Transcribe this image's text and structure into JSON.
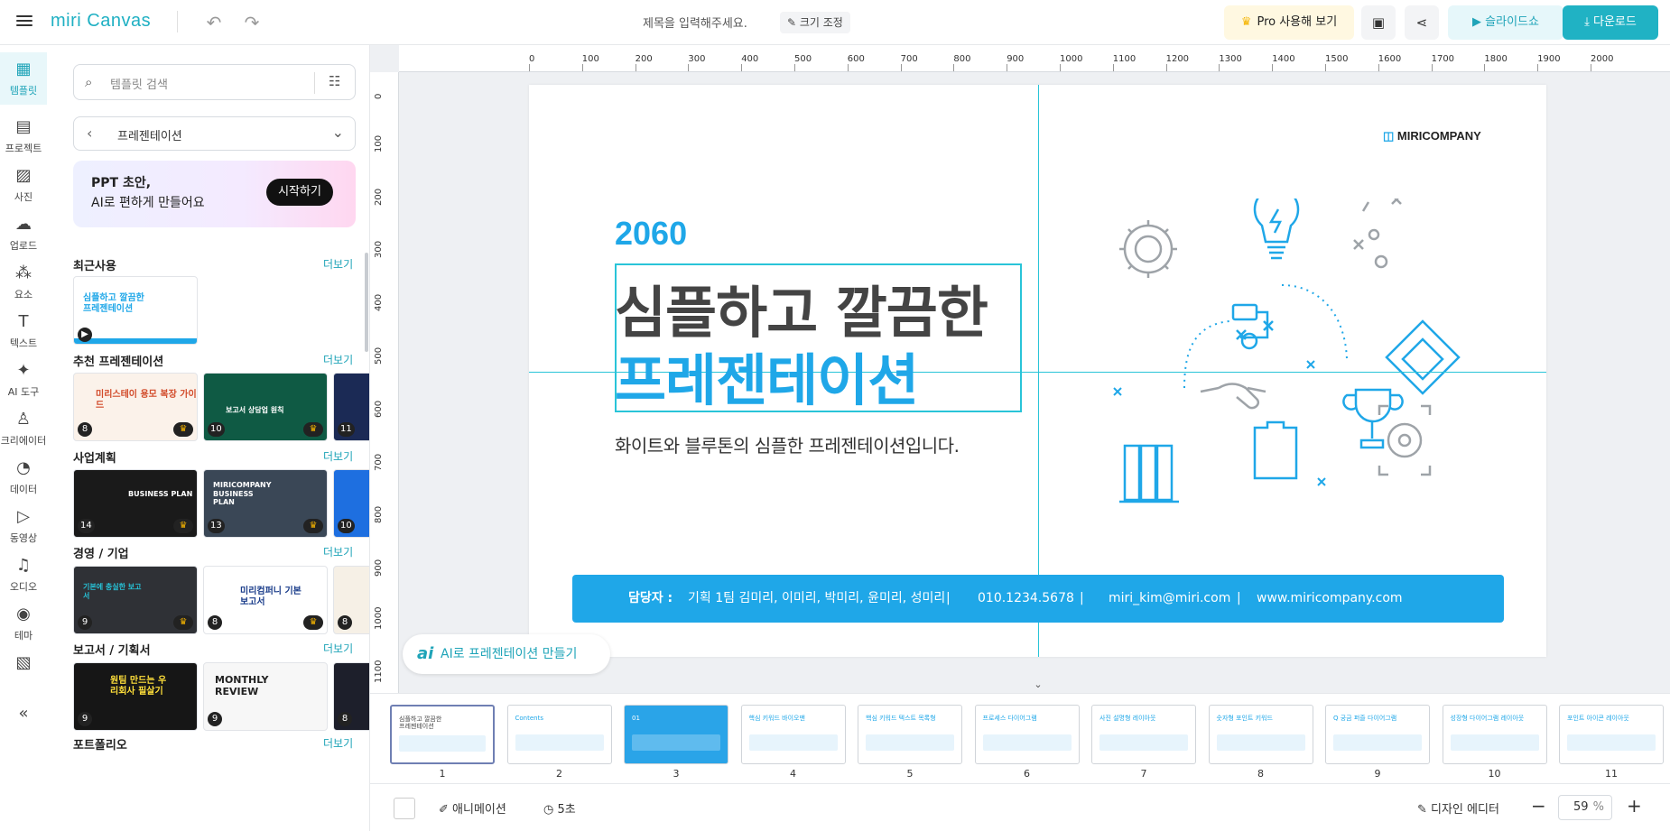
{
  "topbar": {
    "logo": "miri Canvas",
    "doc_title_placeholder": "제목을 입력해주세요.",
    "resize_label": "크기 조정",
    "pro_label": "Pro 사용해 보기",
    "slideshow_label": "슬라이드쇼",
    "download_label": "다운로드",
    "accent_color": "#20b2c4"
  },
  "leftbar": {
    "items": [
      {
        "label": "템플릿",
        "icon": "template-icon"
      },
      {
        "label": "프로젝트",
        "icon": "project-icon"
      },
      {
        "label": "사진",
        "icon": "photo-icon"
      },
      {
        "label": "업로드",
        "icon": "upload-icon"
      },
      {
        "label": "요소",
        "icon": "elements-icon"
      },
      {
        "label": "텍스트",
        "icon": "text-icon"
      },
      {
        "label": "AI 도구",
        "icon": "ai-tools-icon"
      },
      {
        "label": "크리에이터",
        "icon": "creator-icon"
      },
      {
        "label": "데이터",
        "icon": "data-icon"
      },
      {
        "label": "동영상",
        "icon": "video-icon"
      },
      {
        "label": "오디오",
        "icon": "audio-icon"
      },
      {
        "label": "테마",
        "icon": "theme-icon"
      },
      {
        "label": "",
        "icon": "pattern-icon"
      }
    ]
  },
  "panel": {
    "search_placeholder": "템플릿 검색",
    "category": "프레젠테이션",
    "banner_line1": "PPT 초안,",
    "banner_line2": "AI로 편하게 만들어요",
    "banner_button": "시작하기",
    "more_label": "더보기",
    "sections": [
      {
        "title": "최근사용",
        "thumbs": [
          {
            "text": "심플하고 깔끔한 프레젠테이션",
            "badge": ""
          }
        ]
      },
      {
        "title": "추천 프레젠테이션",
        "thumbs": [
          {
            "text": "미리스테이 용모 복장 가이드",
            "badge": "8"
          },
          {
            "text": "보고서 상담업 원칙",
            "badge": "10"
          },
          {
            "text": "",
            "badge": "11"
          }
        ]
      },
      {
        "title": "사업계획",
        "thumbs": [
          {
            "text": "BUSINESS PLAN",
            "badge": "14"
          },
          {
            "text": "MIRICOMPANY BUSINESS PLAN",
            "badge": "13"
          },
          {
            "text": "",
            "badge": "10"
          }
        ]
      },
      {
        "title": "경영 / 기업",
        "thumbs": [
          {
            "text": "기본에 충실한 보고서",
            "badge": "9"
          },
          {
            "text": "미리컴퍼니 기본 보고서",
            "badge": "8"
          },
          {
            "text": "",
            "badge": "8"
          }
        ]
      },
      {
        "title": "보고서 / 기획서",
        "thumbs": [
          {
            "text": "원팀 만드는 우리회사 필살기",
            "badge": "9"
          },
          {
            "text": "MONTHLY REVIEW",
            "badge": "9"
          },
          {
            "text": "",
            "badge": "8"
          }
        ]
      },
      {
        "title": "포트폴리오",
        "thumbs": []
      }
    ]
  },
  "ruler": {
    "top": [
      "0",
      "100",
      "200",
      "300",
      "400",
      "500",
      "600",
      "700",
      "800",
      "900",
      "1000",
      "1100",
      "1200",
      "1300",
      "1400",
      "1500",
      "1600",
      "1700",
      "1800",
      "1900",
      "2000"
    ],
    "left": [
      "0",
      "100",
      "200",
      "300",
      "400",
      "500",
      "600",
      "700",
      "800",
      "900",
      "1000",
      "1100"
    ]
  },
  "slide": {
    "brand": "MIRICOMPANY",
    "year": "2060",
    "title_line1": "심플하고 깔끔한",
    "title_line2": "프레젠테이션",
    "subtitle": "화이트와 블루톤의 심플한 프레젠테이션입니다.",
    "contact_label": "담당자 :",
    "contact_names": "기획 1팀 김미리, 이미리, 박미리, 윤미리, 성미리",
    "contact_phone": "010.1234.5678",
    "contact_email": "miri_kim@miri.com",
    "contact_web": "www.miricompany.com",
    "contact_sep": "|",
    "blue": "#1fa7e8"
  },
  "ai_button": "AI로 프레젠테이션 만들기",
  "thumbnails": [
    {
      "num": "1",
      "title": "심플하고 깔끔한 프레젠테이션"
    },
    {
      "num": "2",
      "title": "Contents"
    },
    {
      "num": "3",
      "title": "01"
    },
    {
      "num": "4",
      "title": "핵심 키워드 바이오맨"
    },
    {
      "num": "5",
      "title": "핵심 키워드 텍스트 목록형"
    },
    {
      "num": "6",
      "title": "프로세스 다이어그램"
    },
    {
      "num": "7",
      "title": "사진 설명형 레이아웃"
    },
    {
      "num": "8",
      "title": "숫자형 포인트 키워드"
    },
    {
      "num": "9",
      "title": "Q 궁금 퍼즐 다이어그램"
    },
    {
      "num": "10",
      "title": "성장형 다이어그램 레이아웃"
    },
    {
      "num": "11",
      "title": "포인트 아이콘 레이아웃"
    }
  ],
  "bottombar": {
    "animation_label": "애니메이션",
    "duration_label": "5초",
    "design_editor_label": "디자인 에디터",
    "zoom_value": "59",
    "zoom_unit": "%"
  }
}
